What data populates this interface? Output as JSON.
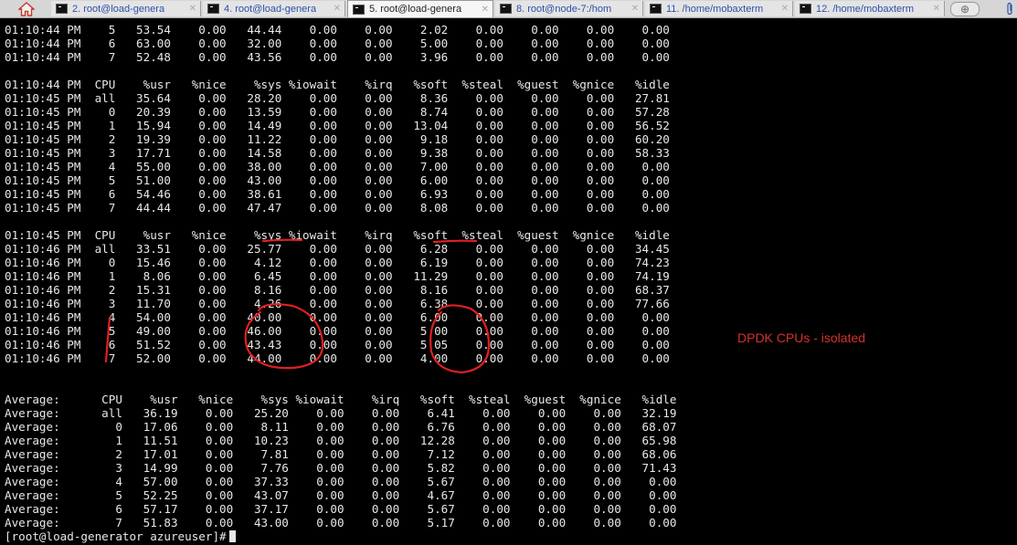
{
  "tabbar": {
    "tabs": [
      {
        "label": "2. root@load-genera",
        "active": false
      },
      {
        "label": "4. root@load-genera",
        "active": false
      },
      {
        "label": "5. root@load-genera",
        "active": true
      },
      {
        "label": "8. root@node-7:/hom",
        "active": false
      },
      {
        "label": "11. /home/mobaxterm",
        "active": false
      },
      {
        "label": "12. /home/mobaxterm",
        "active": false
      }
    ],
    "close_glyph": "✕",
    "add_glyph": "⊕"
  },
  "terminal": {
    "lines": [
      "01:10:44 PM    5   53.54    0.00   44.44    0.00    0.00    2.02    0.00    0.00    0.00    0.00",
      "01:10:44 PM    6   63.00    0.00   32.00    0.00    0.00    5.00    0.00    0.00    0.00    0.00",
      "01:10:44 PM    7   52.48    0.00   43.56    0.00    0.00    3.96    0.00    0.00    0.00    0.00",
      "",
      "01:10:44 PM  CPU    %usr   %nice    %sys %iowait    %irq   %soft  %steal  %guest  %gnice   %idle",
      "01:10:45 PM  all   35.64    0.00   28.20    0.00    0.00    8.36    0.00    0.00    0.00   27.81",
      "01:10:45 PM    0   20.39    0.00   13.59    0.00    0.00    8.74    0.00    0.00    0.00   57.28",
      "01:10:45 PM    1   15.94    0.00   14.49    0.00    0.00   13.04    0.00    0.00    0.00   56.52",
      "01:10:45 PM    2   19.39    0.00   11.22    0.00    0.00    9.18    0.00    0.00    0.00   60.20",
      "01:10:45 PM    3   17.71    0.00   14.58    0.00    0.00    9.38    0.00    0.00    0.00   58.33",
      "01:10:45 PM    4   55.00    0.00   38.00    0.00    0.00    7.00    0.00    0.00    0.00    0.00",
      "01:10:45 PM    5   51.00    0.00   43.00    0.00    0.00    6.00    0.00    0.00    0.00    0.00",
      "01:10:45 PM    6   54.46    0.00   38.61    0.00    0.00    6.93    0.00    0.00    0.00    0.00",
      "01:10:45 PM    7   44.44    0.00   47.47    0.00    0.00    8.08    0.00    0.00    0.00    0.00",
      "",
      "01:10:45 PM  CPU    %usr   %nice    %sys %iowait    %irq   %soft  %steal  %guest  %gnice   %idle",
      "01:10:46 PM  all   33.51    0.00   25.77    0.00    0.00    6.28    0.00    0.00    0.00   34.45",
      "01:10:46 PM    0   15.46    0.00    4.12    0.00    0.00    6.19    0.00    0.00    0.00   74.23",
      "01:10:46 PM    1    8.06    0.00    6.45    0.00    0.00   11.29    0.00    0.00    0.00   74.19",
      "01:10:46 PM    2   15.31    0.00    8.16    0.00    0.00    8.16    0.00    0.00    0.00   68.37",
      "01:10:46 PM    3   11.70    0.00    4.26    0.00    0.00    6.38    0.00    0.00    0.00   77.66",
      "01:10:46 PM    4   54.00    0.00   40.00    0.00    0.00    6.00    0.00    0.00    0.00    0.00",
      "01:10:46 PM    5   49.00    0.00   46.00    0.00    0.00    5.00    0.00    0.00    0.00    0.00",
      "01:10:46 PM    6   51.52    0.00   43.43    0.00    0.00    5.05    0.00    0.00    0.00    0.00",
      "01:10:46 PM    7   52.00    0.00   44.00    0.00    0.00    4.00    0.00    0.00    0.00    0.00",
      "",
      "",
      "Average:      CPU    %usr   %nice    %sys %iowait    %irq   %soft  %steal  %guest  %gnice   %idle",
      "Average:      all   36.19    0.00   25.20    0.00    0.00    6.41    0.00    0.00    0.00   32.19",
      "Average:        0   17.06    0.00    8.11    0.00    0.00    6.76    0.00    0.00    0.00   68.07",
      "Average:        1   11.51    0.00   10.23    0.00    0.00   12.28    0.00    0.00    0.00   65.98",
      "Average:        2   17.01    0.00    7.81    0.00    0.00    7.12    0.00    0.00    0.00   68.06",
      "Average:        3   14.99    0.00    7.76    0.00    0.00    5.82    0.00    0.00    0.00   71.43",
      "Average:        4   57.00    0.00   37.33    0.00    0.00    5.67    0.00    0.00    0.00    0.00",
      "Average:        5   52.25    0.00   43.07    0.00    0.00    4.67    0.00    0.00    0.00    0.00",
      "Average:        6   57.17    0.00   37.17    0.00    0.00    5.67    0.00    0.00    0.00    0.00",
      "Average:        7   51.83    0.00   43.00    0.00    0.00    5.17    0.00    0.00    0.00    0.00"
    ],
    "prompt": "[root@load-generator azureuser]#"
  },
  "annotation": {
    "note": "DPDK CPUs - isolated",
    "color": "#d4322c"
  },
  "colors": {
    "terminal_bg": "#000000",
    "terminal_fg": "#e8e8e8",
    "tabbar_bg": "#d6d6d6",
    "tab_link": "#2c50a8"
  }
}
